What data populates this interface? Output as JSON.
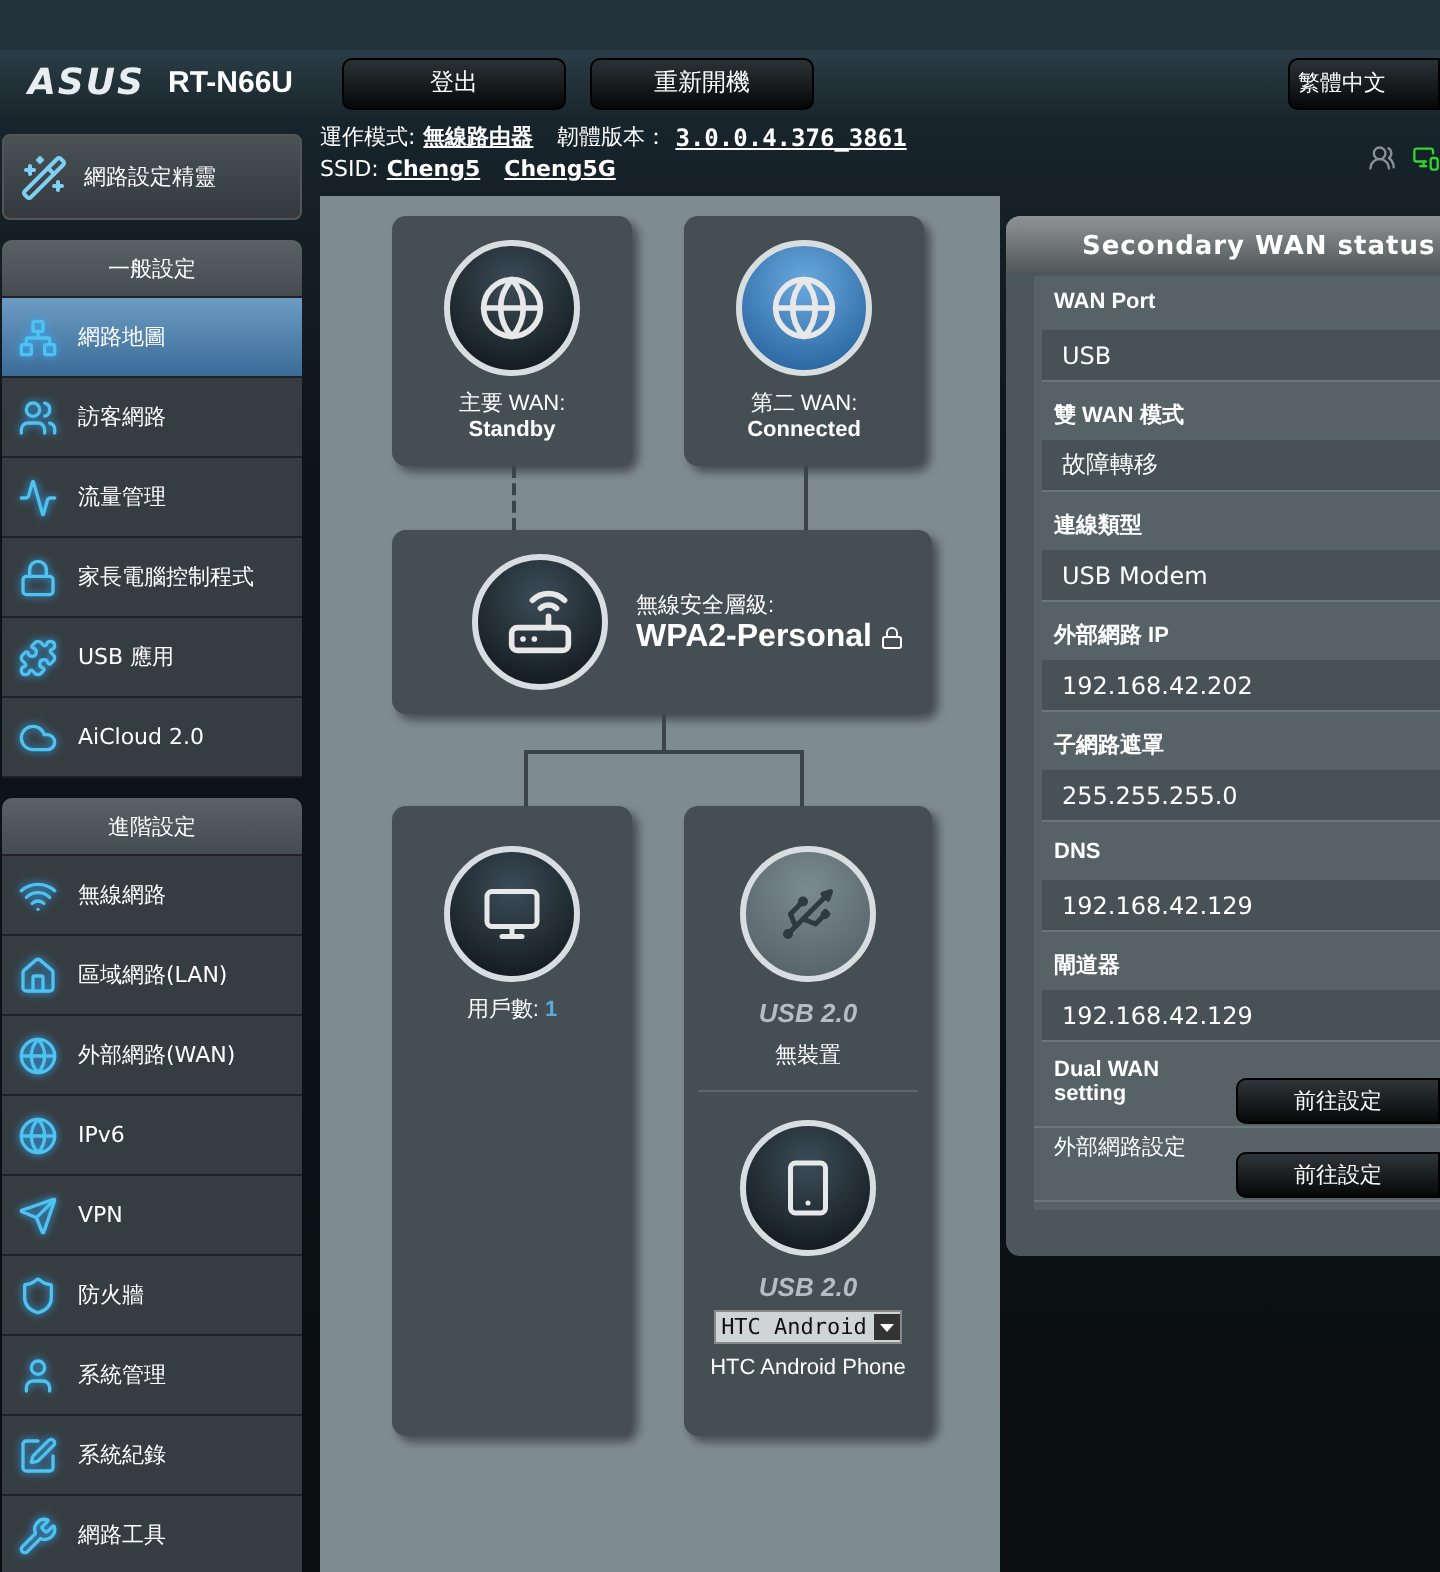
{
  "header": {
    "logo": "ASUS",
    "model": "RT-N66U",
    "buttons": [
      "登出",
      "重新開機"
    ],
    "language": "繁體中文"
  },
  "info": {
    "mode_label": "運作模式:",
    "mode_value": "無線路由器",
    "firmware_label": "韌體版本：",
    "firmware_value": "3.0.0.4.376_3861",
    "ssid_label": "SSID:",
    "ssids": [
      "Cheng5",
      "Cheng5G"
    ]
  },
  "sidebar": {
    "wizard": "網路設定精靈",
    "groups": [
      {
        "title": "一般設定",
        "items": [
          {
            "label": "網路地圖",
            "selected": true
          },
          {
            "label": "訪客網路",
            "selected": false
          },
          {
            "label": "流量管理",
            "selected": false
          },
          {
            "label": "家長電腦控制程式",
            "selected": false
          },
          {
            "label": "USB 應用",
            "selected": false
          },
          {
            "label": "AiCloud 2.0",
            "selected": false
          }
        ]
      },
      {
        "title": "進階設定",
        "items": [
          {
            "label": "無線網路",
            "selected": false
          },
          {
            "label": "區域網路(LAN)",
            "selected": false
          },
          {
            "label": "外部網路(WAN)",
            "selected": false
          },
          {
            "label": "IPv6",
            "selected": false
          },
          {
            "label": "VPN",
            "selected": false
          },
          {
            "label": "防火牆",
            "selected": false
          },
          {
            "label": "系統管理",
            "selected": false
          },
          {
            "label": "系統紀錄",
            "selected": false
          },
          {
            "label": "網路工具",
            "selected": false
          }
        ]
      }
    ]
  },
  "network_map": {
    "wans": [
      {
        "label": "主要 WAN:",
        "status": "Standby",
        "connected": false
      },
      {
        "label": "第二 WAN:",
        "status": "Connected",
        "connected": true
      }
    ],
    "router": {
      "label": "無線安全層級:",
      "value": "WPA2-Personal"
    },
    "clients": {
      "label": "用戶數:",
      "count": "1"
    },
    "usb": [
      {
        "kind": "empty",
        "port": "USB 2.0",
        "device": "無裝置"
      },
      {
        "kind": "modem",
        "port": "USB 2.0",
        "select": "HTC Android",
        "device": "HTC Android Phone"
      }
    ]
  },
  "status_panel": {
    "title": "Secondary WAN status",
    "fields": [
      {
        "label": "WAN Port",
        "value": "USB"
      },
      {
        "label": "雙 WAN 模式",
        "value": "故障轉移"
      },
      {
        "label": "連線類型",
        "value": "USB Modem"
      },
      {
        "label": "外部網路 IP",
        "value": "192.168.42.202"
      },
      {
        "label": "子網路遮罩",
        "value": "255.255.255.0"
      },
      {
        "label": "DNS",
        "value": "192.168.42.129"
      },
      {
        "label": "閘道器",
        "value": "192.168.42.129"
      }
    ],
    "actions": [
      {
        "label": "Dual WAN setting",
        "button": "前往設定"
      },
      {
        "label": "外部網路設定",
        "button": "前往設定"
      }
    ]
  }
}
